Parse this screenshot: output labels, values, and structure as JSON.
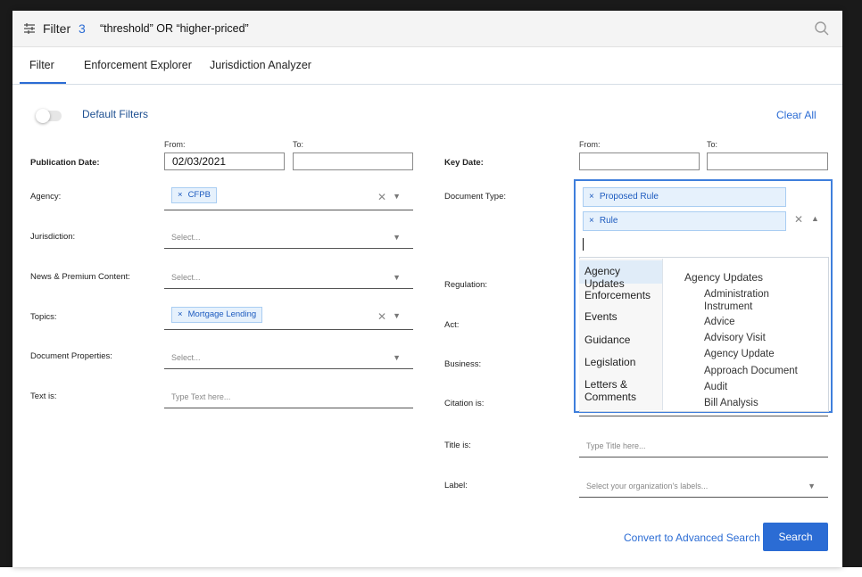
{
  "header": {
    "filter_label": "Filter",
    "filter_count": "3",
    "query": "“threshold” OR “higher-priced”"
  },
  "tabs": [
    {
      "label": "Filter"
    },
    {
      "label": "Enforcement Explorer"
    },
    {
      "label": "Jurisdiction Analyzer"
    }
  ],
  "default_filters_label": "Default Filters",
  "clear_all": "Clear All",
  "left": {
    "publication_date": {
      "label": "Publication Date:",
      "from_label": "From:",
      "to_label": "To:",
      "from_value": "02/03/2021",
      "to_value": ""
    },
    "agency": {
      "label": "Agency:",
      "chip": "CFPB"
    },
    "jurisdiction": {
      "label": "Jurisdiction:",
      "placeholder": "Select..."
    },
    "news": {
      "label": "News & Premium Content:",
      "placeholder": "Select..."
    },
    "topics": {
      "label": "Topics:",
      "chip": "Mortgage Lending"
    },
    "document_properties": {
      "label": "Document Properties:",
      "placeholder": "Select..."
    },
    "text_is": {
      "label": "Text is:",
      "placeholder": "Type Text here..."
    }
  },
  "right": {
    "key_date": {
      "label": "Key Date:",
      "from_label": "From:",
      "to_label": "To:"
    },
    "document_type": {
      "label": "Document Type:",
      "chips": [
        "Proposed Rule",
        "Rule"
      ],
      "categories": [
        "Agency Updates",
        "Enforcements",
        "Events",
        "Guidance",
        "Legislation",
        "Letters & Comments"
      ],
      "selected_category": "Agency Updates",
      "options_header": "Agency Updates",
      "options": [
        "Administration Instrument",
        "Advice",
        "Advisory Visit",
        "Agency Update",
        "Approach Document",
        "Audit",
        "Bill Analysis"
      ]
    },
    "regulation_label": "Regulation:",
    "act_label": "Act:",
    "business_label": "Business:",
    "citation_label": "Citation is:",
    "title_is": {
      "label": "Title is:",
      "placeholder": "Type Title here..."
    },
    "label_field": {
      "label": "Label:",
      "placeholder": "Select your organization's labels..."
    }
  },
  "footer": {
    "convert": "Convert to Advanced Search",
    "search": "Search"
  }
}
